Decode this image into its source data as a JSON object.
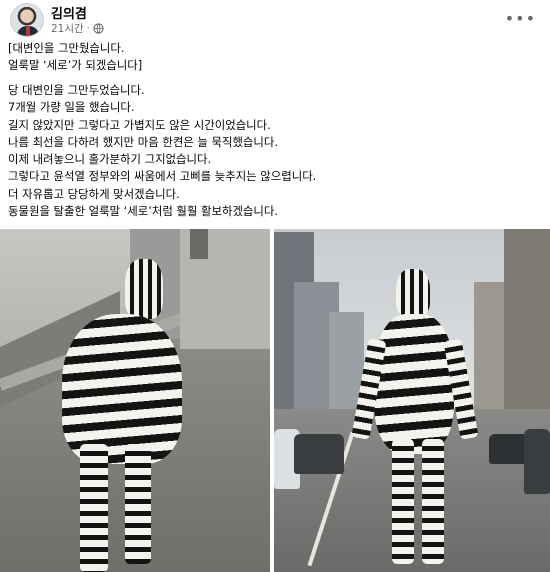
{
  "post": {
    "author": "김의겸",
    "time": "21시간",
    "dot": "·",
    "more_icon": "more-options-icon",
    "privacy_icon": "globe-icon"
  },
  "paragraphs": [
    [
      "[대변인을 그만뒀습니다.",
      "얼룩말 ‘세로’가 되겠습니다]"
    ],
    [
      "당 대변인을 그만두었습니다.",
      "7개월 가량 일을 했습니다.",
      "길지 않았지만 그렇다고 가볍지도 않은 시간이었습니다.",
      "나름 최선을 다하려 했지만 마음 한켠은 늘 묵직했습니다."
    ],
    [
      "이제 내려놓으니 홀가분하기 그지없습니다.",
      "그렇다고 윤석열 정부와의 싸움에서 고삐를 늦추지는 않으렵니다.",
      "더 자유롭고 당당하게 맞서겠습니다.",
      "동물원을 탈출한 얼룩말 ‘세로’처럼 훨훨 활보하겠습니다."
    ]
  ],
  "photos": [
    "zebra-walking-alley",
    "zebra-walking-city-street"
  ]
}
